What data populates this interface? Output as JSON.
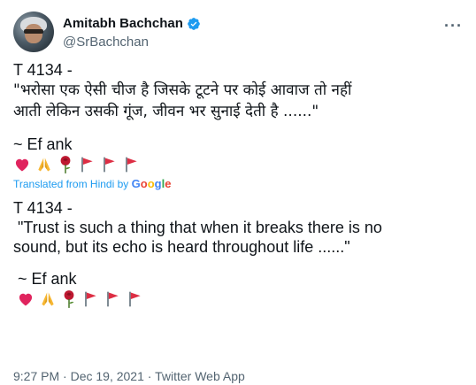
{
  "author": {
    "name": "Amitabh Bachchan",
    "handle": "@SrBachchan",
    "verified": true,
    "more_icon": "more-horizontal-icon"
  },
  "tweet": {
    "id_line": "T 4134 -",
    "hindi_line1": "\"भरोसा एक ऐसी चीज है जिसके टूटने पर कोई आवाज तो नहीं",
    "hindi_line2": "आती लेकिन उसकी गूंज, जीवन भर सुनाई देती है ......\"",
    "signature": "~ Ef ank",
    "emojis": [
      "heart-icon",
      "folded-hands-icon",
      "rose-icon",
      "red-flag-icon",
      "red-flag-icon",
      "red-flag-icon"
    ]
  },
  "translation": {
    "label_prefix": "Translated from Hindi by ",
    "google": [
      "G",
      "o",
      "o",
      "g",
      "l",
      "e"
    ],
    "google_colors": [
      "#4285f4",
      "#ea4335",
      "#fbbc05",
      "#4285f4",
      "#34a853",
      "#ea4335"
    ],
    "id_line": "T 4134 -",
    "line1": " \"Trust is such a thing that when it breaks there is no",
    "line2": "sound, but its echo is heard throughout life ......\"",
    "signature": " ~ Ef ank"
  },
  "meta": {
    "time": "9:27 PM",
    "sep": "·",
    "date": "Dec 19, 2021",
    "source": "Twitter Web App"
  },
  "colors": {
    "text": "#0f1419",
    "secondary": "#536471",
    "accent": "#1d9bf0",
    "heart": "#e0245e",
    "hands": "#f7b733",
    "rose": "#be1931",
    "flag": "#dd2e44"
  }
}
